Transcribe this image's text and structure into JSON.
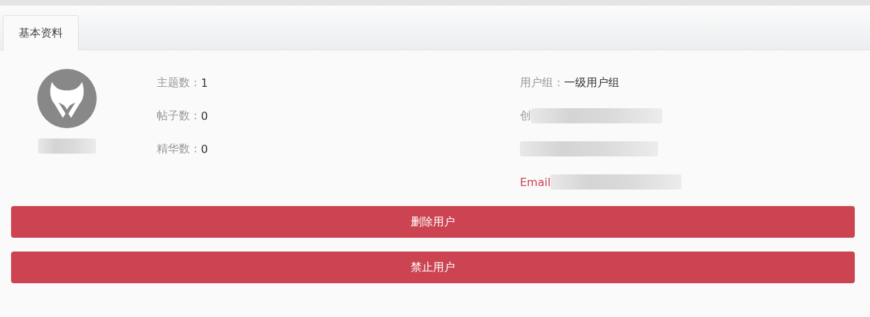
{
  "tabs": [
    {
      "label": "基本资料",
      "selected": true
    }
  ],
  "profile": {
    "avatar": {
      "kind": "avatar"
    },
    "name_redacted": true
  },
  "stats": [
    {
      "label": "主题数：",
      "value": "1"
    },
    {
      "label": "帖子数：",
      "value": "0"
    },
    {
      "label": "精华数：",
      "value": "0"
    }
  ],
  "info": [
    {
      "kind": "text",
      "label": "用户组：",
      "value": "一级用户组"
    },
    {
      "kind": "redacted",
      "label": "创"
    },
    {
      "kind": "redacted"
    },
    {
      "kind": "redacted",
      "label": "Email",
      "color": "#cc4452"
    }
  ],
  "buttons": [
    {
      "label": "删除用户"
    },
    {
      "label": "禁止用户"
    }
  ]
}
